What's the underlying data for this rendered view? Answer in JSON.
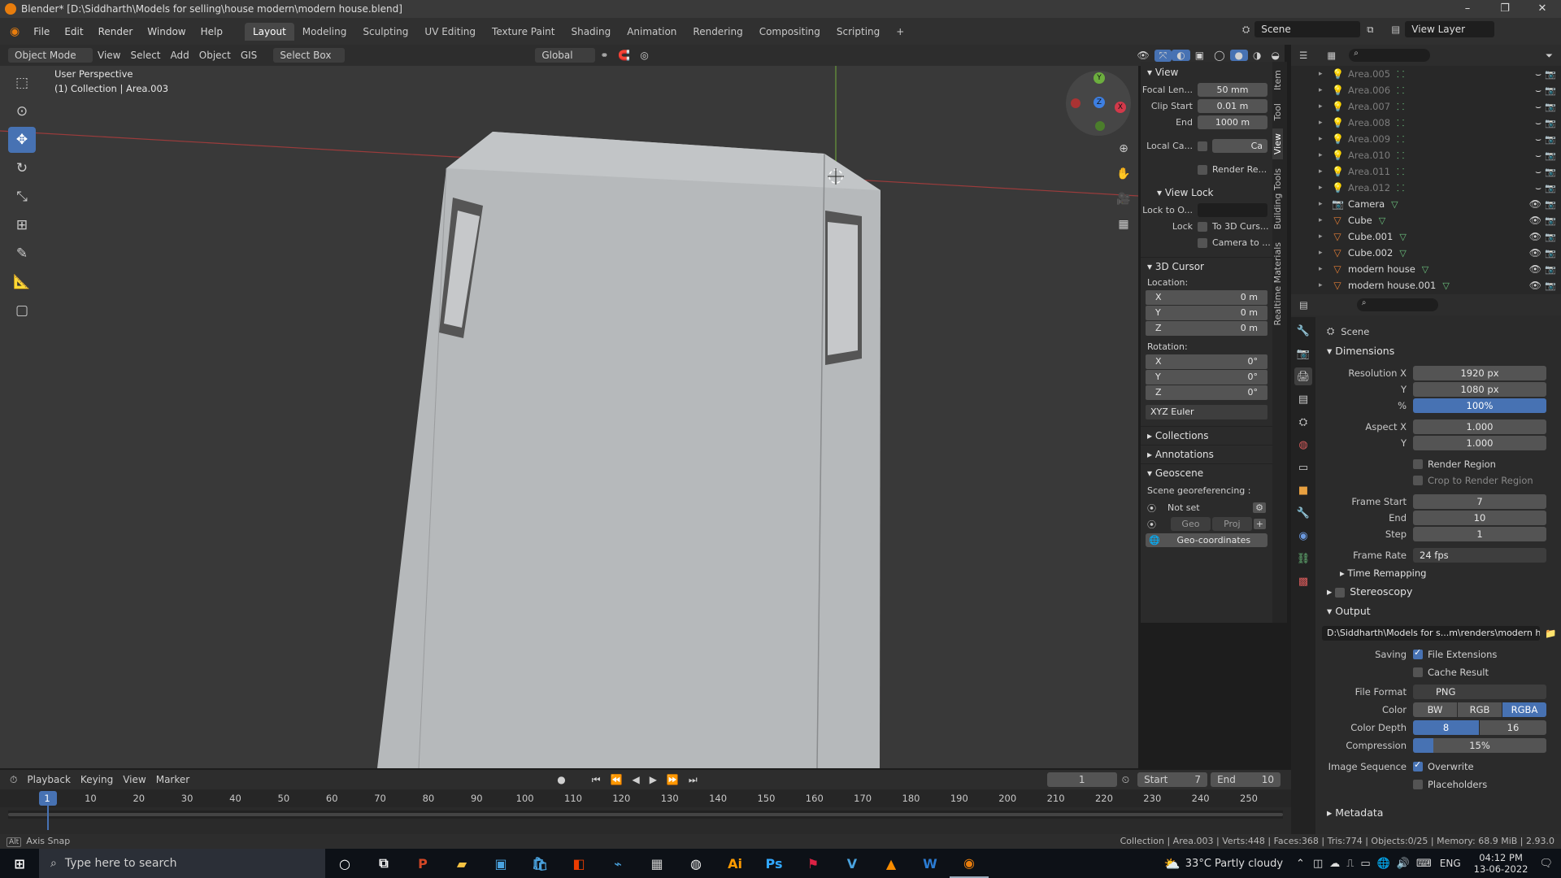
{
  "title": "Blender* [D:\\Siddharth\\Models for selling\\house modern\\modern house.blend]",
  "menu": [
    "File",
    "Edit",
    "Render",
    "Window",
    "Help"
  ],
  "workspaces": [
    "Layout",
    "Modeling",
    "Sculpting",
    "UV Editing",
    "Texture Paint",
    "Shading",
    "Animation",
    "Rendering",
    "Compositing",
    "Scripting"
  ],
  "scene_name": "Scene",
  "view_layer": "View Layer",
  "viewport_header": {
    "mode": "Object Mode",
    "view": "View",
    "select": "Select",
    "add": "Add",
    "object": "Object",
    "gis": "GIS",
    "select_box": "Select Box",
    "orientation": "Global"
  },
  "viewport": {
    "perspective": "User Perspective",
    "collection": "(1) Collection | Area.003"
  },
  "npanel": {
    "view_header": "View",
    "focal_label": "Focal Len...",
    "focal_value": "50 mm",
    "clip_start_label": "Clip Start",
    "clip_start_value": "0.01 m",
    "clip_end_label": "End",
    "clip_end_value": "1000 m",
    "local_camera_label": "Local Ca...",
    "local_camera_value": "Ca",
    "render_region": "Render Re...",
    "view_lock": "View Lock",
    "lock_to_object_label": "Lock to O...",
    "lock_label": "Lock",
    "to_3d_cursor": "To 3D Curs...",
    "camera_to": "Camera to ...",
    "cursor_header": "3D Cursor",
    "location_label": "Location:",
    "loc": [
      {
        "axis": "X",
        "value": "0 m"
      },
      {
        "axis": "Y",
        "value": "0 m"
      },
      {
        "axis": "Z",
        "value": "0 m"
      }
    ],
    "rotation_label": "Rotation:",
    "rot": [
      {
        "axis": "X",
        "value": "0°"
      },
      {
        "axis": "Y",
        "value": "0°"
      },
      {
        "axis": "Z",
        "value": "0°"
      }
    ],
    "rotation_mode": "XYZ Euler",
    "collections": "Collections",
    "annotations": "Annotations",
    "geoscene": "Geoscene",
    "scene_georef": "Scene georeferencing :",
    "not_set": "Not set",
    "geo": "Geo",
    "proj": "Proj",
    "geo_coordinates": "Geo-coordinates"
  },
  "side_tabs": [
    "Item",
    "Tool",
    "View",
    "Building Tools",
    "Realtime Materials"
  ],
  "outliner": [
    {
      "name": "Area.005",
      "dim": true
    },
    {
      "name": "Area.006",
      "dim": true
    },
    {
      "name": "Area.007",
      "dim": true
    },
    {
      "name": "Area.008",
      "dim": true
    },
    {
      "name": "Area.009",
      "dim": true
    },
    {
      "name": "Area.010",
      "dim": true
    },
    {
      "name": "Area.011",
      "dim": true
    },
    {
      "name": "Area.012",
      "dim": true
    },
    {
      "name": "Camera",
      "dim": false
    },
    {
      "name": "Cube",
      "dim": false
    },
    {
      "name": "Cube.001",
      "dim": false
    },
    {
      "name": "Cube.002",
      "dim": false
    },
    {
      "name": "modern house",
      "dim": false
    },
    {
      "name": "modern house.001",
      "dim": false
    }
  ],
  "properties": {
    "scene": "Scene",
    "dimensions": "Dimensions",
    "res_x_label": "Resolution X",
    "res_x": "1920 px",
    "res_y_label": "Y",
    "res_y": "1080 px",
    "pct_label": "%",
    "pct": "100%",
    "aspect_x_label": "Aspect X",
    "aspect_x": "1.000",
    "aspect_y_label": "Y",
    "aspect_y": "1.000",
    "render_region": "Render Region",
    "crop_region": "Crop to Render Region",
    "frame_start_label": "Frame Start",
    "frame_start": "7",
    "frame_end_label": "End",
    "frame_end": "10",
    "step_label": "Step",
    "step": "1",
    "frame_rate_label": "Frame Rate",
    "frame_rate": "24 fps",
    "time_remapping": "Time Remapping",
    "stereoscopy": "Stereoscopy",
    "output": "Output",
    "output_path": "D:\\Siddharth\\Models for s...m\\renders\\modern house",
    "saving_label": "Saving",
    "file_extensions": "File Extensions",
    "cache_result": "Cache Result",
    "file_format_label": "File Format",
    "file_format": "PNG",
    "color_label": "Color",
    "color_options": [
      "BW",
      "RGB",
      "RGBA"
    ],
    "color_depth_label": "Color Depth",
    "color_depth": [
      "8",
      "16"
    ],
    "compression_label": "Compression",
    "compression": "15%",
    "compression_level": 0.15,
    "image_sequence_label": "Image Sequence",
    "overwrite": "Overwrite",
    "placeholders": "Placeholders",
    "metadata": "Metadata"
  },
  "timeline": {
    "playback": "Playback",
    "keying": "Keying",
    "view": "View",
    "marker": "Marker",
    "current_frame": "1",
    "start_label": "Start",
    "start": "7",
    "end_label": "End",
    "end": "10",
    "ticks": [
      "1",
      "10",
      "20",
      "30",
      "40",
      "50",
      "60",
      "70",
      "80",
      "90",
      "100",
      "110",
      "120",
      "130",
      "140",
      "150",
      "160",
      "170",
      "180",
      "190",
      "200",
      "210",
      "220",
      "230",
      "240",
      "250"
    ]
  },
  "statusbar": {
    "left": "Axis Snap",
    "right": "Collection | Area.003 | Verts:448 | Faces:368 | Tris:774 | Objects:0/25 | Memory: 68.9 MiB | 2.93.0"
  },
  "taskbar": {
    "search_placeholder": "Type here to search",
    "weather": "33°C  Partly cloudy",
    "lang": "ENG",
    "time": "04:12 PM",
    "date": "13-06-2022"
  },
  "colors": {
    "accent": "#4772b3",
    "blender_orange": "#e87d0d",
    "viewport_bg": "#393939"
  }
}
